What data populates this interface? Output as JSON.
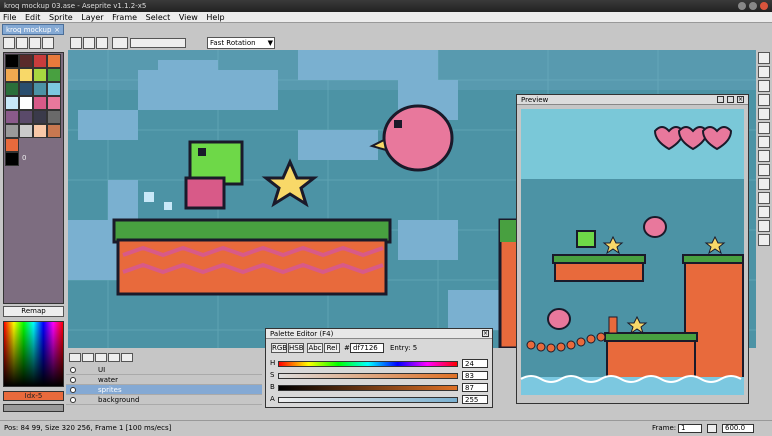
{
  "window": {
    "title": "kroq mockup 03.ase - Aseprite v1.1.2-x5"
  },
  "menu": [
    "File",
    "Edit",
    "Sprite",
    "Layer",
    "Frame",
    "Select",
    "View",
    "Help"
  ],
  "toolbar": {
    "rotation_mode": "Fast Rotation"
  },
  "file_tab": {
    "label": "kroq mockup"
  },
  "palette": {
    "colors": [
      "#000000",
      "#5a2a2a",
      "#c83c3c",
      "#e87a3c",
      "#f0a850",
      "#f8d868",
      "#a8d840",
      "#48a040",
      "#2a6e3a",
      "#2a4e6e",
      "#4c93a5",
      "#7cc8e0",
      "#c8e8f8",
      "#ffffff",
      "#d85a88",
      "#e8789c",
      "#8a5a8a",
      "#5a4a6a",
      "#3a3a4a",
      "#6a6a6a",
      "#9a9a9a",
      "#cacaca",
      "#f8c8a8",
      "#c87850",
      "#e86a3c"
    ],
    "index_label": "0"
  },
  "buttons": {
    "remap": "Remap",
    "color_mode": "Idx-5"
  },
  "layers": [
    {
      "name": "UI",
      "selected": false
    },
    {
      "name": "water",
      "selected": false
    },
    {
      "name": "sprites",
      "selected": true
    },
    {
      "name": "background",
      "selected": false
    }
  ],
  "preview": {
    "title": "Preview"
  },
  "palette_editor": {
    "title": "Palette Editor (F4)",
    "modes": [
      "RGB",
      "HSB",
      "Abc",
      "Rel"
    ],
    "hex": "df7126",
    "entry": "Entry: 5",
    "sliders": [
      {
        "label": "H",
        "value": "24"
      },
      {
        "label": "S",
        "value": "83"
      },
      {
        "label": "B",
        "value": "87"
      },
      {
        "label": "A",
        "value": "255"
      }
    ]
  },
  "status": {
    "text": "Pos: 84 99, Size 320 256, Frame 1 [100 ms/ecs]",
    "frame_label": "Frame:",
    "frame_value": "1",
    "zoom": "600.0"
  },
  "colors": {
    "accent": "#84a9d4",
    "canvas_bg": "#4c93a5",
    "grass": "#48a040",
    "dirt": "#e86a3c"
  }
}
